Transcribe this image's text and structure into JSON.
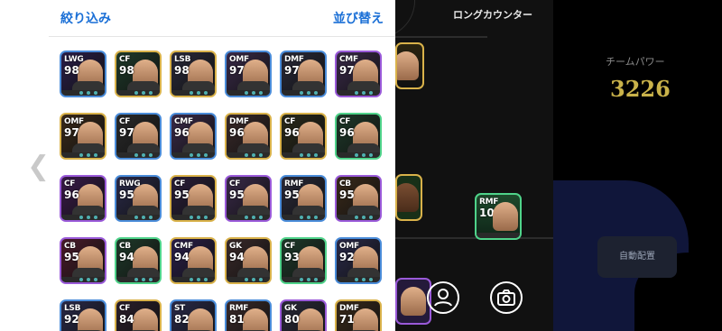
{
  "panel": {
    "filter_label": "絞り込み",
    "sort_label": "並び替え"
  },
  "field": {
    "formation_title": "ロングカウンター"
  },
  "team": {
    "power_label": "チームパワー",
    "power_value": "3226",
    "auto_assign_label": "自動配置"
  },
  "field_players": [
    {
      "position": "RMF",
      "rating": "105"
    }
  ],
  "players": [
    {
      "position": "LWG",
      "rating": "98"
    },
    {
      "position": "CF",
      "rating": "98"
    },
    {
      "position": "LSB",
      "rating": "98"
    },
    {
      "position": "OMF",
      "rating": "97"
    },
    {
      "position": "DMF",
      "rating": "97"
    },
    {
      "position": "CMF",
      "rating": "97"
    },
    {
      "position": "OMF",
      "rating": "97"
    },
    {
      "position": "CF",
      "rating": "97"
    },
    {
      "position": "CMF",
      "rating": "96"
    },
    {
      "position": "DMF",
      "rating": "96"
    },
    {
      "position": "CF",
      "rating": "96"
    },
    {
      "position": "CF",
      "rating": "96"
    },
    {
      "position": "CF",
      "rating": "96"
    },
    {
      "position": "RWG",
      "rating": "95"
    },
    {
      "position": "CF",
      "rating": "95"
    },
    {
      "position": "CF",
      "rating": "95"
    },
    {
      "position": "RMF",
      "rating": "95"
    },
    {
      "position": "CB",
      "rating": "95"
    },
    {
      "position": "CB",
      "rating": "95"
    },
    {
      "position": "CB",
      "rating": "94"
    },
    {
      "position": "CMF",
      "rating": "94"
    },
    {
      "position": "GK",
      "rating": "94"
    },
    {
      "position": "CF",
      "rating": "93"
    },
    {
      "position": "OMF",
      "rating": "92"
    },
    {
      "position": "LSB",
      "rating": "92"
    },
    {
      "position": "CF",
      "rating": "84"
    },
    {
      "position": "ST",
      "rating": "82"
    },
    {
      "position": "RMF",
      "rating": "81"
    },
    {
      "position": "GK",
      "rating": "80"
    },
    {
      "position": "DMF",
      "rating": "71"
    }
  ]
}
